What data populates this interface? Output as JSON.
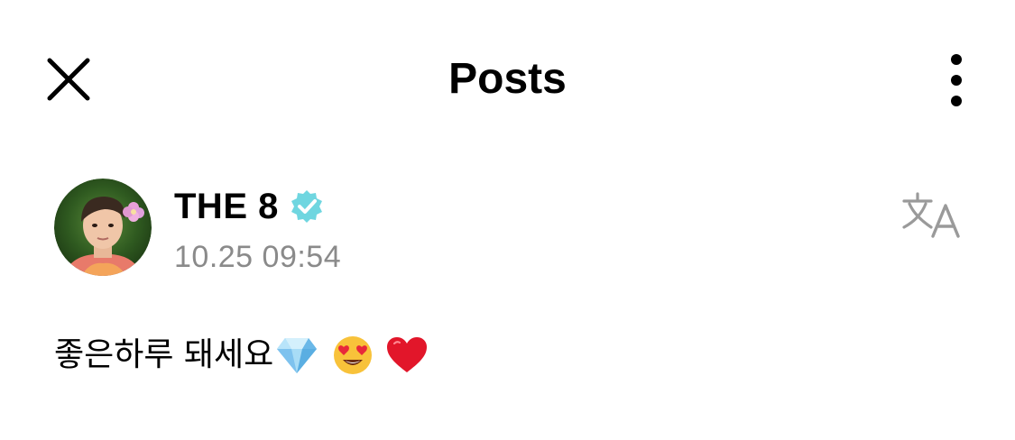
{
  "header": {
    "title": "Posts"
  },
  "post": {
    "author": "THE 8",
    "verified": true,
    "timestamp": "10.25 09:54",
    "text": "좋은하루 돼세요",
    "emojis": [
      "gem-icon",
      "heart-eyes-face-icon",
      "red-heart-icon"
    ]
  },
  "colors": {
    "verified_badge": "#6fd6e0",
    "timestamp": "#8a8a8a",
    "translate_icon": "#9a9a9a"
  }
}
